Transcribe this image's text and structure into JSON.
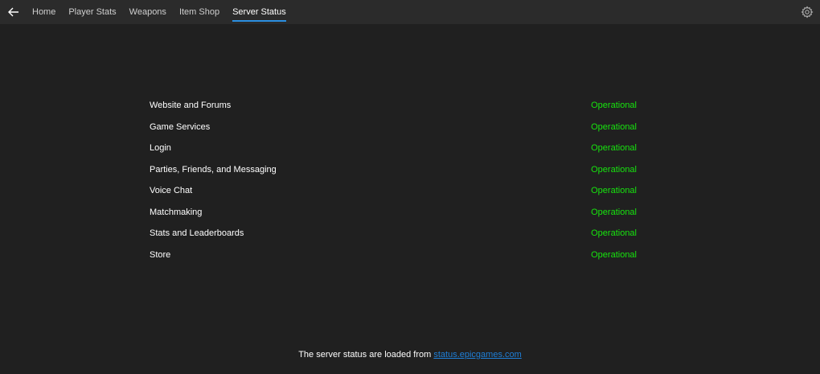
{
  "nav": {
    "back_icon": "back-arrow-icon",
    "tabs": [
      {
        "label": "Home"
      },
      {
        "label": "Player Stats"
      },
      {
        "label": "Weapons"
      },
      {
        "label": "Item Shop"
      },
      {
        "label": "Server Status"
      }
    ],
    "active_tab": "Server Status",
    "settings_icon": "gear-icon"
  },
  "services": [
    {
      "name": "Website and Forums",
      "status": "Operational"
    },
    {
      "name": "Game Services",
      "status": "Operational"
    },
    {
      "name": "Login",
      "status": "Operational"
    },
    {
      "name": "Parties, Friends, and Messaging",
      "status": "Operational"
    },
    {
      "name": "Voice Chat",
      "status": "Operational"
    },
    {
      "name": "Matchmaking",
      "status": "Operational"
    },
    {
      "name": "Stats and Leaderboards",
      "status": "Operational"
    },
    {
      "name": "Store",
      "status": "Operational"
    }
  ],
  "footer": {
    "text": "The server status are loaded from",
    "link_text": "status.epicgames.com"
  },
  "colors": {
    "background": "#202020",
    "topbar": "#2b2b2b",
    "accent": "#2b8fe0",
    "operational": "#17e40e",
    "link": "#1e7fd8"
  }
}
